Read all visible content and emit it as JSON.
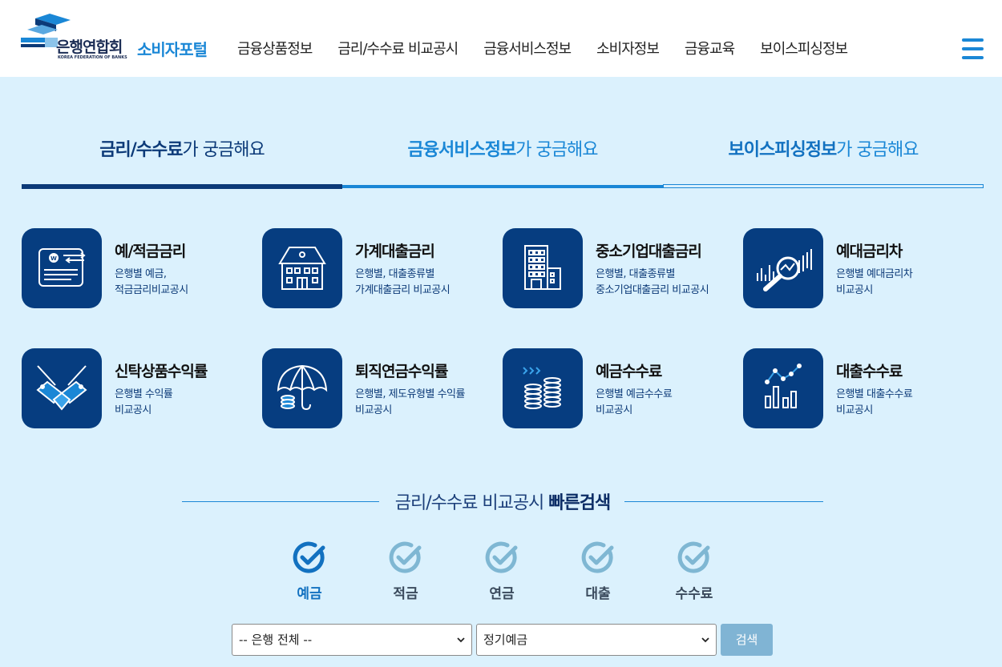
{
  "header": {
    "logo_name": "은행연합회",
    "logo_sub": "KOREA FEDERATION OF BANKS",
    "portal_name": "소비자포털",
    "nav": [
      {
        "label": "금융상품정보"
      },
      {
        "label": "금리/수수료 비교공시"
      },
      {
        "label": "금융서비스정보"
      },
      {
        "label": "소비자정보"
      },
      {
        "label": "금융교육"
      },
      {
        "label": "보이스피싱정보"
      }
    ],
    "menu_icon": "hamburger-icon"
  },
  "tabs": [
    {
      "strong": "금리/수수료",
      "rest": "가 궁금해요",
      "active": true
    },
    {
      "strong": "금융서비스정보",
      "rest": "가 궁금해요",
      "active": false
    },
    {
      "strong": "보이스피싱정보",
      "rest": "가 궁금해요",
      "active": false
    }
  ],
  "cards": [
    {
      "title": "예/적금금리",
      "desc1": "은행별 예금,",
      "desc2": "적금금리비교공시",
      "icon": "passbook-won-icon"
    },
    {
      "title": "가계대출금리",
      "desc1": "은행별, 대출종류별",
      "desc2": "가계대출금리 비교공시",
      "icon": "house-icon"
    },
    {
      "title": "중소기업대출금리",
      "desc1": "은행별, 대출종류별",
      "desc2": "중소기업대출금리 비교공시",
      "icon": "building-icon"
    },
    {
      "title": "예대금리차",
      "desc1": "은행별 예대금리차",
      "desc2": "비교공시",
      "icon": "magnifier-chart-icon"
    },
    {
      "title": "신탁상품수익률",
      "desc1": "은행별 수익률",
      "desc2": "비교공시",
      "icon": "handshake-icon"
    },
    {
      "title": "퇴직연금수익률",
      "desc1": "은행별, 제도유형별 수익률",
      "desc2": "비교공시",
      "icon": "umbrella-coins-icon"
    },
    {
      "title": "예금수수료",
      "desc1": "은행별 예금수수료",
      "desc2": "비교공시",
      "icon": "coin-stack-icon"
    },
    {
      "title": "대출수수료",
      "desc1": "은행별 대출수수료",
      "desc2": "비교공시",
      "icon": "line-bar-chart-icon"
    }
  ],
  "quick_search": {
    "title_plain": "금리/수수료 비교공시 ",
    "title_strong": "빠른검색",
    "options": [
      {
        "label": "예금",
        "active": true
      },
      {
        "label": "적금",
        "active": false
      },
      {
        "label": "연금",
        "active": false
      },
      {
        "label": "대출",
        "active": false
      },
      {
        "label": "수수료",
        "active": false
      }
    ],
    "bank_select": "-- 은행 전체 --",
    "product_select": "정기예금",
    "search_label": "검색"
  },
  "colors": {
    "navy": "#063d80",
    "accent": "#1a87d6",
    "background": "#dbf1fd",
    "check_active": "#1271c0",
    "check_inactive": "#7fb7d3"
  }
}
